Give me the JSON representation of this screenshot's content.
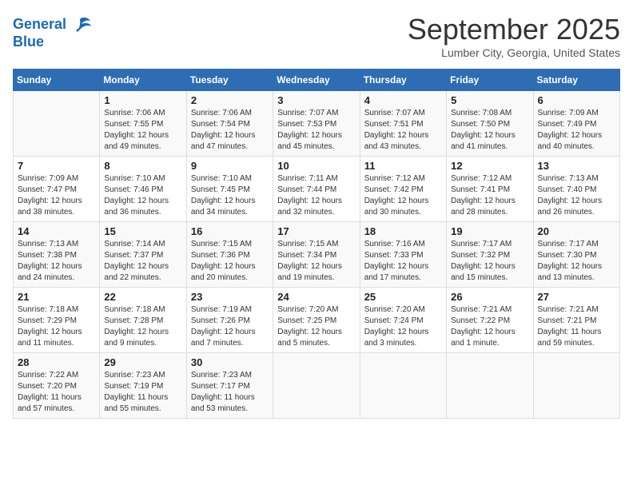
{
  "header": {
    "logo_line1": "General",
    "logo_line2": "Blue",
    "month_year": "September 2025",
    "location": "Lumber City, Georgia, United States"
  },
  "calendar": {
    "days_of_week": [
      "Sunday",
      "Monday",
      "Tuesday",
      "Wednesday",
      "Thursday",
      "Friday",
      "Saturday"
    ],
    "weeks": [
      [
        {
          "day": "",
          "info": ""
        },
        {
          "day": "1",
          "info": "Sunrise: 7:06 AM\nSunset: 7:55 PM\nDaylight: 12 hours\nand 49 minutes."
        },
        {
          "day": "2",
          "info": "Sunrise: 7:06 AM\nSunset: 7:54 PM\nDaylight: 12 hours\nand 47 minutes."
        },
        {
          "day": "3",
          "info": "Sunrise: 7:07 AM\nSunset: 7:53 PM\nDaylight: 12 hours\nand 45 minutes."
        },
        {
          "day": "4",
          "info": "Sunrise: 7:07 AM\nSunset: 7:51 PM\nDaylight: 12 hours\nand 43 minutes."
        },
        {
          "day": "5",
          "info": "Sunrise: 7:08 AM\nSunset: 7:50 PM\nDaylight: 12 hours\nand 41 minutes."
        },
        {
          "day": "6",
          "info": "Sunrise: 7:09 AM\nSunset: 7:49 PM\nDaylight: 12 hours\nand 40 minutes."
        }
      ],
      [
        {
          "day": "7",
          "info": "Sunrise: 7:09 AM\nSunset: 7:47 PM\nDaylight: 12 hours\nand 38 minutes."
        },
        {
          "day": "8",
          "info": "Sunrise: 7:10 AM\nSunset: 7:46 PM\nDaylight: 12 hours\nand 36 minutes."
        },
        {
          "day": "9",
          "info": "Sunrise: 7:10 AM\nSunset: 7:45 PM\nDaylight: 12 hours\nand 34 minutes."
        },
        {
          "day": "10",
          "info": "Sunrise: 7:11 AM\nSunset: 7:44 PM\nDaylight: 12 hours\nand 32 minutes."
        },
        {
          "day": "11",
          "info": "Sunrise: 7:12 AM\nSunset: 7:42 PM\nDaylight: 12 hours\nand 30 minutes."
        },
        {
          "day": "12",
          "info": "Sunrise: 7:12 AM\nSunset: 7:41 PM\nDaylight: 12 hours\nand 28 minutes."
        },
        {
          "day": "13",
          "info": "Sunrise: 7:13 AM\nSunset: 7:40 PM\nDaylight: 12 hours\nand 26 minutes."
        }
      ],
      [
        {
          "day": "14",
          "info": "Sunrise: 7:13 AM\nSunset: 7:38 PM\nDaylight: 12 hours\nand 24 minutes."
        },
        {
          "day": "15",
          "info": "Sunrise: 7:14 AM\nSunset: 7:37 PM\nDaylight: 12 hours\nand 22 minutes."
        },
        {
          "day": "16",
          "info": "Sunrise: 7:15 AM\nSunset: 7:36 PM\nDaylight: 12 hours\nand 20 minutes."
        },
        {
          "day": "17",
          "info": "Sunrise: 7:15 AM\nSunset: 7:34 PM\nDaylight: 12 hours\nand 19 minutes."
        },
        {
          "day": "18",
          "info": "Sunrise: 7:16 AM\nSunset: 7:33 PM\nDaylight: 12 hours\nand 17 minutes."
        },
        {
          "day": "19",
          "info": "Sunrise: 7:17 AM\nSunset: 7:32 PM\nDaylight: 12 hours\nand 15 minutes."
        },
        {
          "day": "20",
          "info": "Sunrise: 7:17 AM\nSunset: 7:30 PM\nDaylight: 12 hours\nand 13 minutes."
        }
      ],
      [
        {
          "day": "21",
          "info": "Sunrise: 7:18 AM\nSunset: 7:29 PM\nDaylight: 12 hours\nand 11 minutes."
        },
        {
          "day": "22",
          "info": "Sunrise: 7:18 AM\nSunset: 7:28 PM\nDaylight: 12 hours\nand 9 minutes."
        },
        {
          "day": "23",
          "info": "Sunrise: 7:19 AM\nSunset: 7:26 PM\nDaylight: 12 hours\nand 7 minutes."
        },
        {
          "day": "24",
          "info": "Sunrise: 7:20 AM\nSunset: 7:25 PM\nDaylight: 12 hours\nand 5 minutes."
        },
        {
          "day": "25",
          "info": "Sunrise: 7:20 AM\nSunset: 7:24 PM\nDaylight: 12 hours\nand 3 minutes."
        },
        {
          "day": "26",
          "info": "Sunrise: 7:21 AM\nSunset: 7:22 PM\nDaylight: 12 hours\nand 1 minute."
        },
        {
          "day": "27",
          "info": "Sunrise: 7:21 AM\nSunset: 7:21 PM\nDaylight: 11 hours\nand 59 minutes."
        }
      ],
      [
        {
          "day": "28",
          "info": "Sunrise: 7:22 AM\nSunset: 7:20 PM\nDaylight: 11 hours\nand 57 minutes."
        },
        {
          "day": "29",
          "info": "Sunrise: 7:23 AM\nSunset: 7:19 PM\nDaylight: 11 hours\nand 55 minutes."
        },
        {
          "day": "30",
          "info": "Sunrise: 7:23 AM\nSunset: 7:17 PM\nDaylight: 11 hours\nand 53 minutes."
        },
        {
          "day": "",
          "info": ""
        },
        {
          "day": "",
          "info": ""
        },
        {
          "day": "",
          "info": ""
        },
        {
          "day": "",
          "info": ""
        }
      ]
    ]
  }
}
